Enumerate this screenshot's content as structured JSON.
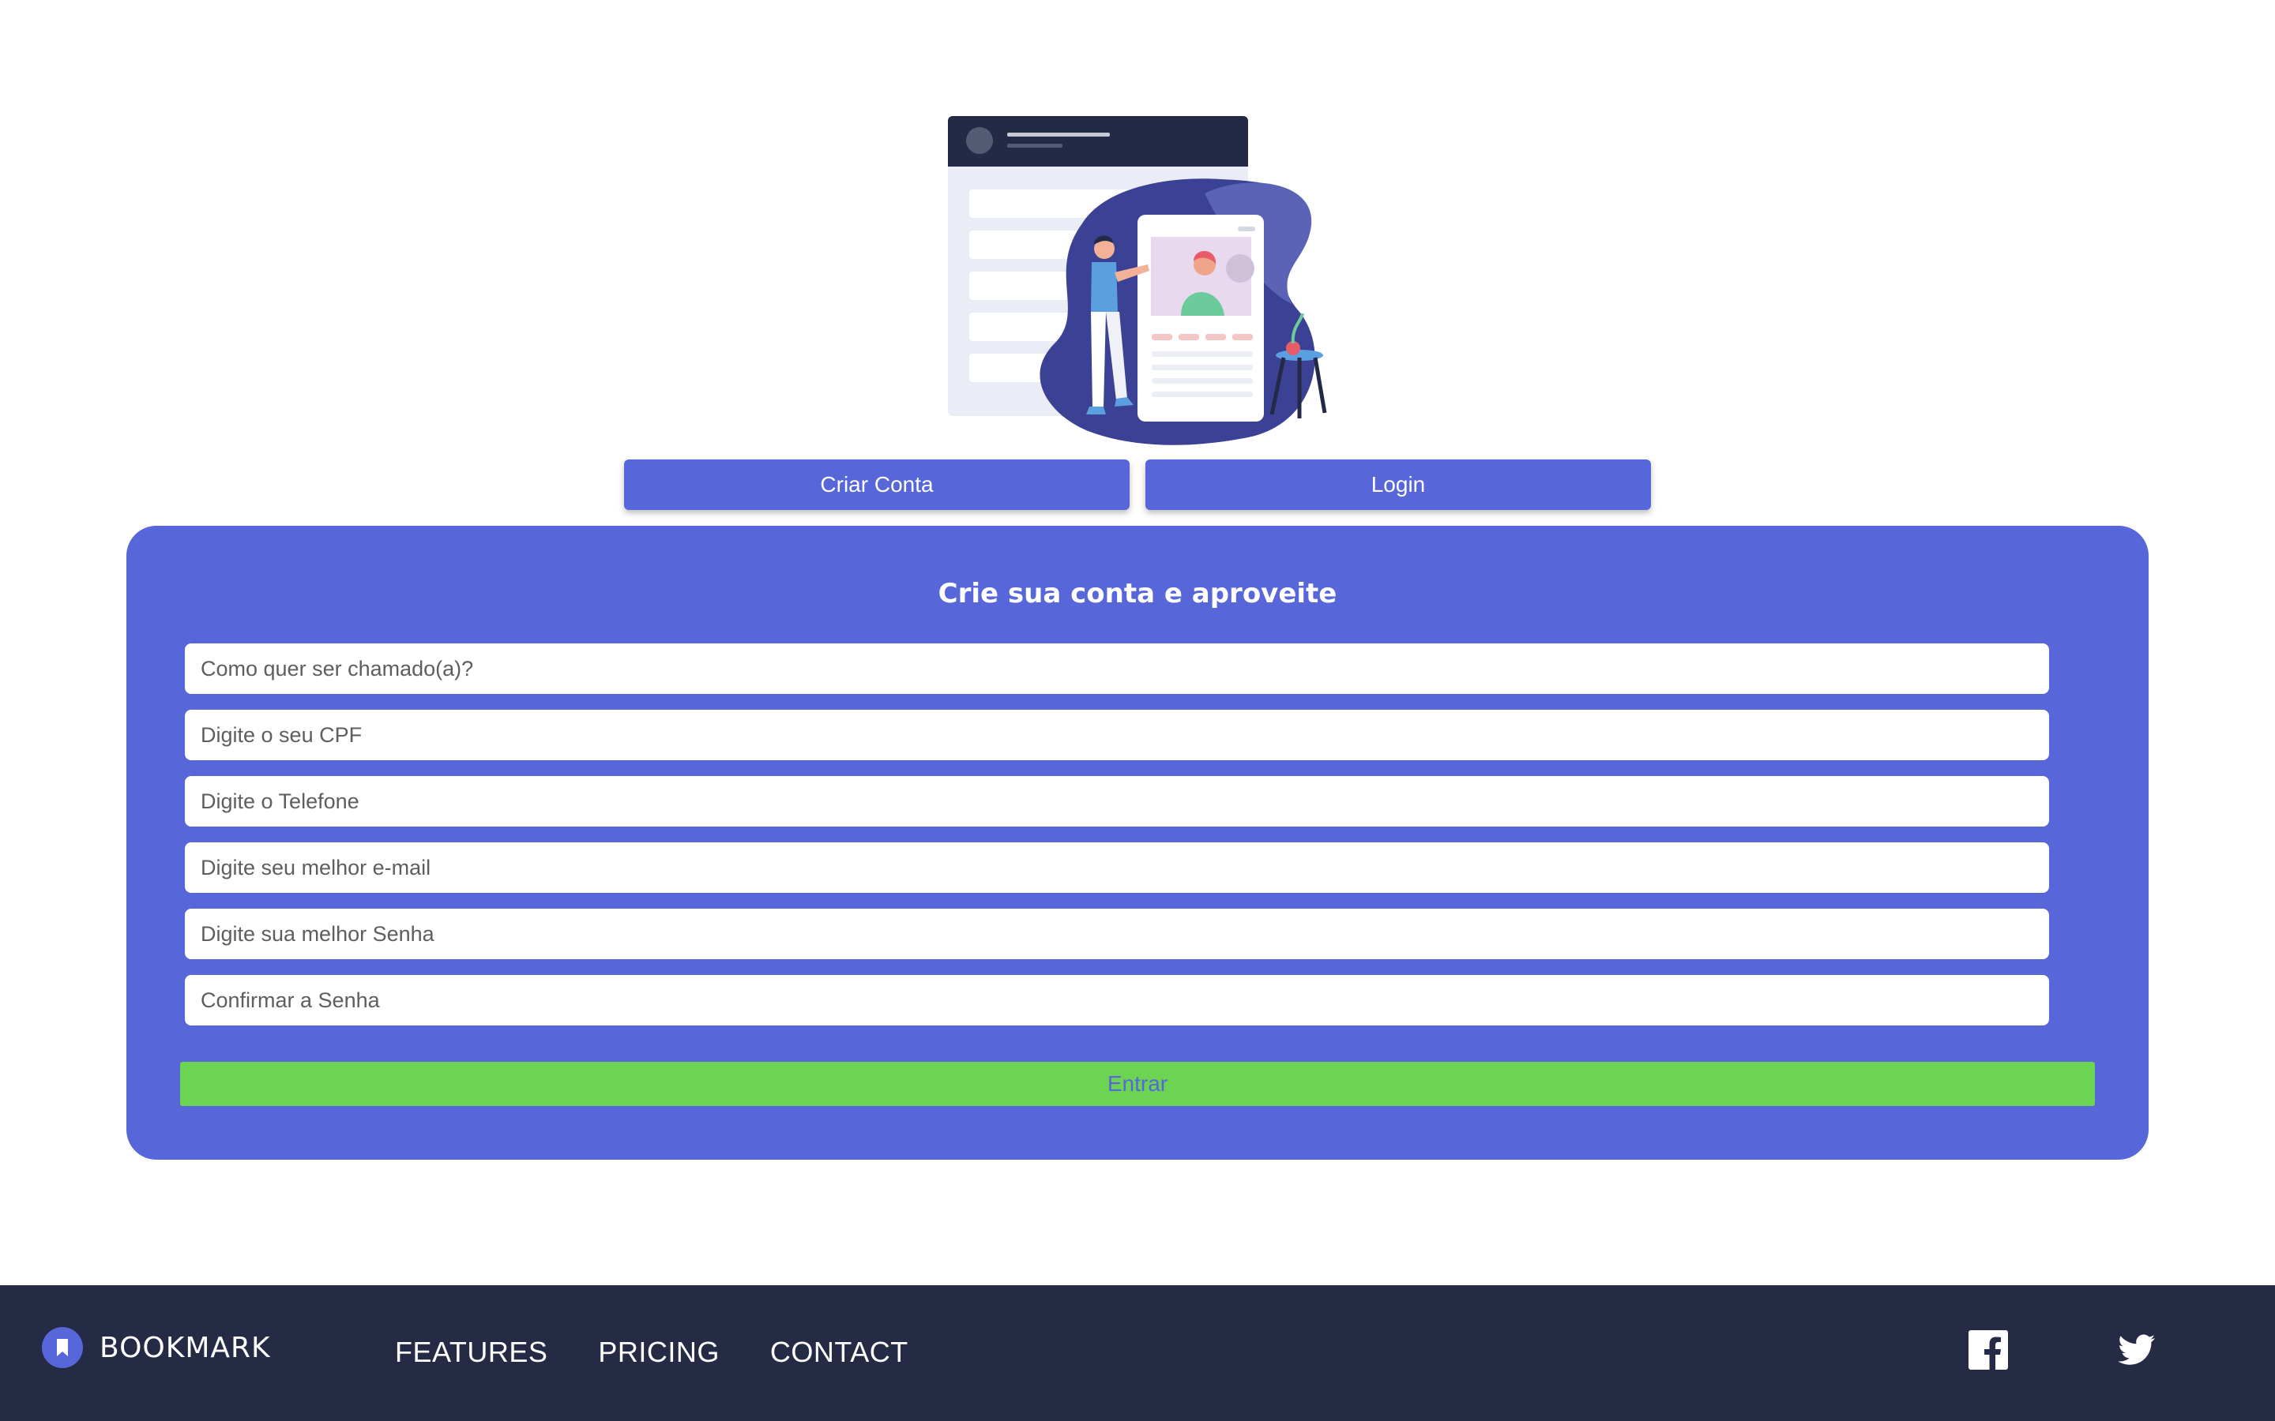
{
  "tabs": {
    "create_account": "Criar Conta",
    "login": "Login"
  },
  "form": {
    "title": "Crie sua conta e aproveite",
    "fields": [
      {
        "placeholder": "Como quer ser chamado(a)?"
      },
      {
        "placeholder": "Digite o seu CPF"
      },
      {
        "placeholder": "Digite o Telefone"
      },
      {
        "placeholder": "Digite seu melhor e-mail"
      },
      {
        "placeholder": "Digite sua melhor Senha"
      },
      {
        "placeholder": "Confirmar a Senha"
      }
    ],
    "submit_label": "Entrar"
  },
  "footer": {
    "brand": "BOOKMARK",
    "nav": [
      "FEATURES",
      "PRICING",
      "CONTACT"
    ],
    "social": [
      "facebook-icon",
      "twitter-icon"
    ]
  },
  "colors": {
    "primary": "#5767d9",
    "success": "#6cd353",
    "footer_bg": "#252b45",
    "illustration_dark": "#242a45"
  }
}
